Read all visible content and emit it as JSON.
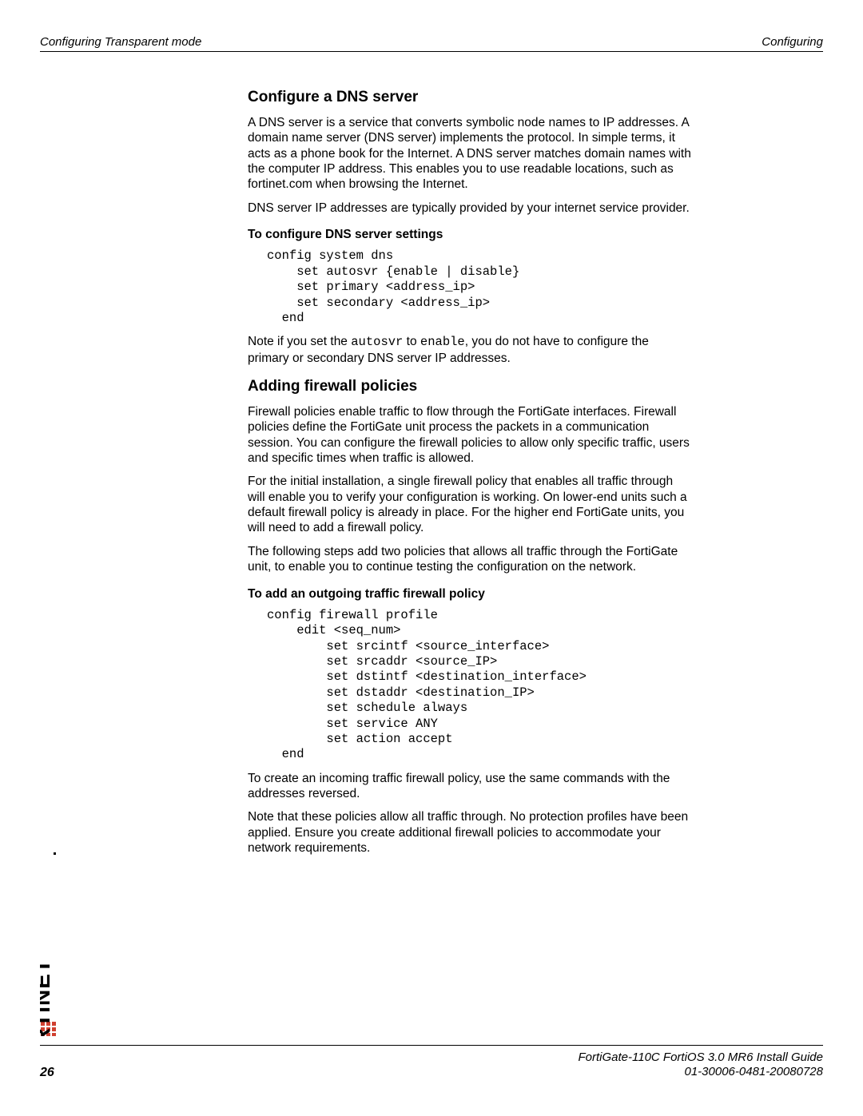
{
  "header": {
    "left": "Configuring Transparent mode",
    "right": "Configuring"
  },
  "section1": {
    "title": "Configure a DNS server",
    "p1": "A DNS server is a service that converts symbolic node names to IP addresses. A domain name server (DNS server) implements the protocol. In simple terms, it acts as a phone book for the Internet. A DNS server matches domain names with the computer IP address. This enables you to use readable locations, such as fortinet.com when browsing the Internet.",
    "p2": "DNS server IP addresses are typically provided by your internet service provider.",
    "subheading": "To configure DNS server settings",
    "code": "config system dns\n    set autosvr {enable | disable}\n    set primary <address_ip>\n    set secondary <address_ip>\n  end",
    "note_pre": "Note if you set the ",
    "note_code1": "autosvr",
    "note_mid": " to ",
    "note_code2": "enable",
    "note_post": ", you do not have to configure the primary or secondary DNS server IP addresses."
  },
  "section2": {
    "title": "Adding firewall policies",
    "p1": "Firewall policies enable traffic to flow through the FortiGate interfaces. Firewall policies define the FortiGate unit process the packets in a communication session. You can configure the firewall policies to allow only specific traffic, users and specific times when traffic is allowed.",
    "p2": "For the initial installation, a single firewall policy that enables all traffic through will enable you to verify your configuration is working. On lower-end units such a default firewall policy is already in place. For the higher end FortiGate units, you will need to add a firewall policy.",
    "p3": "The following steps add two policies that allows all traffic through the FortiGate unit, to enable you to continue testing the configuration on the network.",
    "subheading": "To add an outgoing traffic firewall policy",
    "code": "config firewall profile\n    edit <seq_num>\n        set srcintf <source_interface>\n        set srcaddr <source_IP>\n        set dstintf <destination_interface>\n        set dstaddr <destination_IP>\n        set schedule always\n        set service ANY\n        set action accept\n  end",
    "p4": "To create an incoming traffic firewall policy, use the same commands with the addresses reversed.",
    "p5": "Note that these policies allow all traffic through. No protection profiles have been applied. Ensure you create additional firewall policies to accommodate your network requirements."
  },
  "footer": {
    "page_number": "26",
    "line1": "FortiGate-110C FortiOS 3.0 MR6 Install Guide",
    "line2": "01-30006-0481-20080728"
  }
}
